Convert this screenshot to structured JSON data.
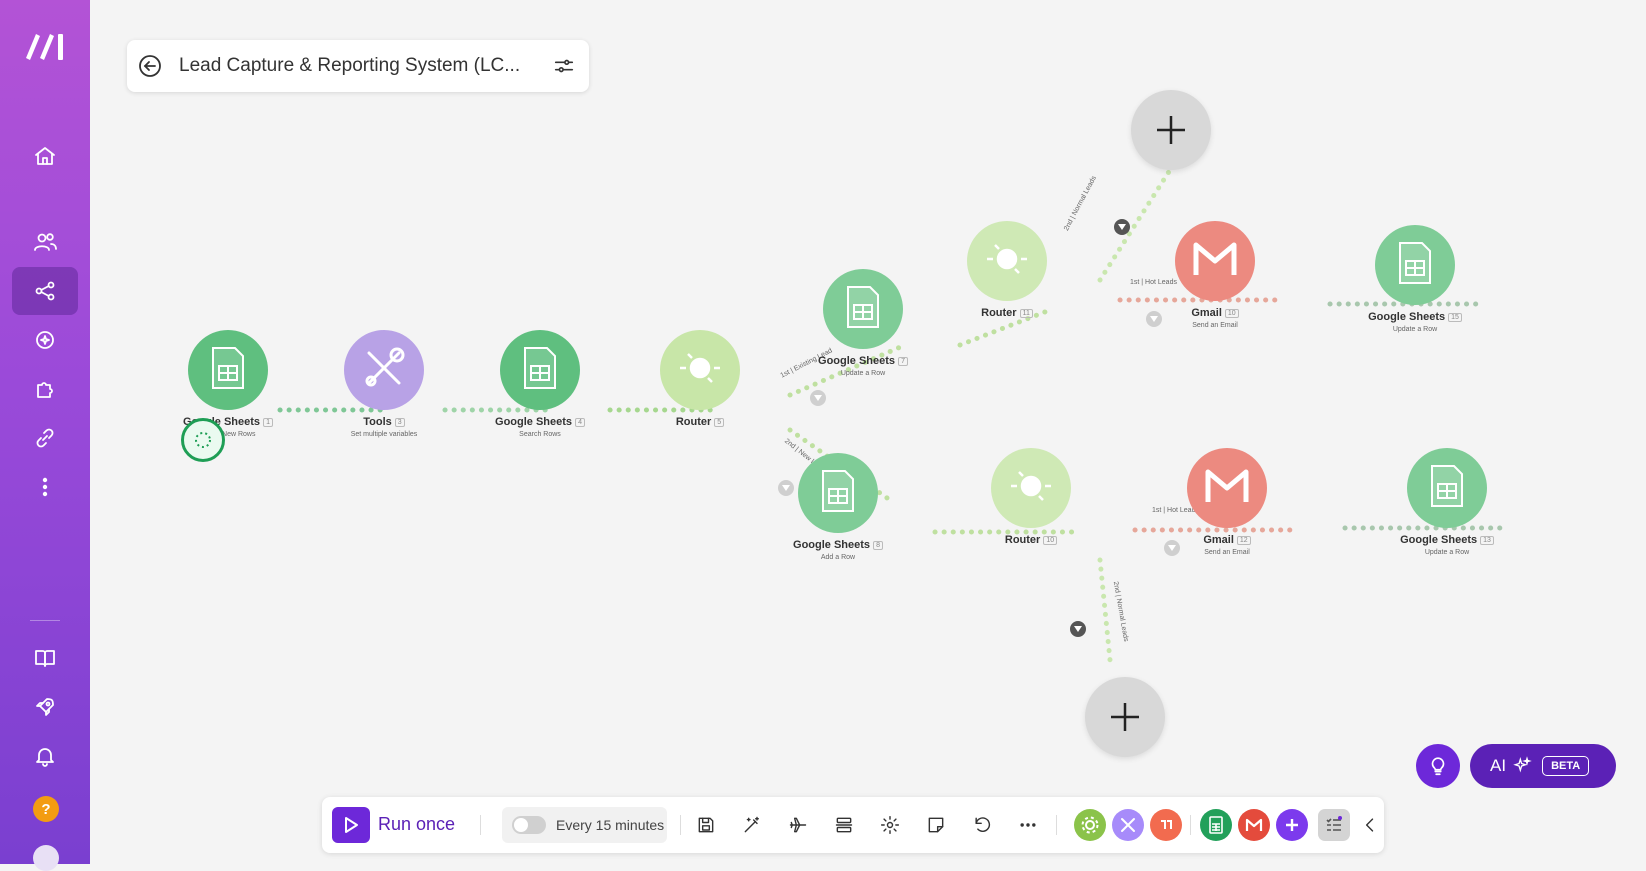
{
  "scenario": {
    "title": "Lead Capture & Reporting System (LC..."
  },
  "sidebar": {
    "items": [
      {
        "icon": "home-icon"
      },
      {
        "icon": "team-icon"
      },
      {
        "icon": "scenarios-icon",
        "active": true
      },
      {
        "icon": "ai-agents-icon"
      },
      {
        "icon": "apps-icon"
      },
      {
        "icon": "connections-icon"
      },
      {
        "icon": "more-icon"
      },
      {
        "icon": "docs-icon"
      },
      {
        "icon": "rocket-icon"
      },
      {
        "icon": "notifications-icon"
      }
    ],
    "help_label": "?"
  },
  "nodes": [
    {
      "id": "gs1",
      "app": "Google Sheets",
      "num": "1",
      "action": "Watch New Rows",
      "color": "#5fbf7f"
    },
    {
      "id": "tools",
      "app": "Tools",
      "num": "3",
      "action": "Set multiple variables",
      "color": "#b8a2e6"
    },
    {
      "id": "gs4",
      "app": "Google Sheets",
      "num": "4",
      "action": "Search Rows",
      "color": "#5fbf7f"
    },
    {
      "id": "r5",
      "app": "Router",
      "num": "5",
      "action": "",
      "color": "#c8e6a8"
    },
    {
      "id": "gs7",
      "app": "Google Sheets",
      "num": "7",
      "action": "Update a Row",
      "color": "#7fcc97"
    },
    {
      "id": "r11",
      "app": "Router",
      "num": "11",
      "action": "",
      "color": "#cfe9b5"
    },
    {
      "id": "gm10",
      "app": "Gmail",
      "num": "10",
      "action": "Send an Email",
      "color": "#ec8a80"
    },
    {
      "id": "gs15",
      "app": "Google Sheets",
      "num": "15",
      "action": "Update a Row",
      "color": "#7fcc97"
    },
    {
      "id": "gs8",
      "app": "Google Sheets",
      "num": "8",
      "action": "Add a Row",
      "color": "#7fcc97"
    },
    {
      "id": "r10b",
      "app": "Router",
      "num": "10",
      "action": "",
      "color": "#cfe9b5"
    },
    {
      "id": "gm12",
      "app": "Gmail",
      "num": "12",
      "action": "Send an Email",
      "color": "#ec8a80"
    },
    {
      "id": "gs13",
      "app": "Google Sheets",
      "num": "13",
      "action": "Update a Row",
      "color": "#7fcc97"
    }
  ],
  "routes": {
    "existing_lead": "1st | Existing Lead",
    "new_lead": "2nd | New Lead",
    "hot_leads_top": "1st | Hot Leads",
    "normal_leads_top": "2nd | Normal Leads",
    "hot_leads_bottom": "1st | Hot Leads",
    "normal_leads_bottom": "2nd | Normal Leads"
  },
  "toolbar": {
    "run_label": "Run once",
    "schedule_label": "Every 15 minutes",
    "icons": [
      "save-icon",
      "magic-wand-icon",
      "airplane-icon",
      "layout-icon",
      "gear-icon",
      "notes-icon",
      "undo-icon",
      "more-icon"
    ],
    "mini_apps": [
      {
        "name": "router-mini",
        "color": "#8bc34a"
      },
      {
        "name": "tools-mini",
        "color": "#a78bfa"
      },
      {
        "name": "flow-control-mini",
        "color": "#f26b4f"
      },
      {
        "name": "google-sheets-mini",
        "color": "#22a05a"
      },
      {
        "name": "gmail-mini",
        "color": "#e44b3c"
      },
      {
        "name": "add-mini",
        "color": "#7c3aed"
      }
    ]
  },
  "ai": {
    "label": "AI",
    "badge": "BETA"
  },
  "colors": {
    "accent": "#6d28d9",
    "sheets": "#22a05a",
    "gmail": "#e44b3c"
  }
}
